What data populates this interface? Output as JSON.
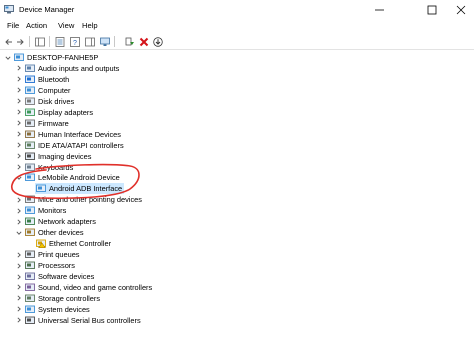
{
  "window": {
    "title": "Device Manager"
  },
  "menu": [
    {
      "label": "File",
      "x": 7
    },
    {
      "label": "Action",
      "x": 26
    },
    {
      "label": "View",
      "x": 58
    },
    {
      "label": "Help",
      "x": 82
    }
  ],
  "tree": {
    "root": "DESKTOP-FANHE5P",
    "items": [
      {
        "label": "Audio inputs and outputs",
        "icon": "speaker-icon",
        "expanded": false
      },
      {
        "label": "Bluetooth",
        "icon": "bluetooth-icon",
        "expanded": false
      },
      {
        "label": "Computer",
        "icon": "computer-icon",
        "expanded": false
      },
      {
        "label": "Disk drives",
        "icon": "disk-drive-icon",
        "expanded": false
      },
      {
        "label": "Display adapters",
        "icon": "display-adapter-icon",
        "expanded": false
      },
      {
        "label": "Firmware",
        "icon": "firmware-icon",
        "expanded": false
      },
      {
        "label": "Human Interface Devices",
        "icon": "hid-icon",
        "expanded": false
      },
      {
        "label": "IDE ATA/ATAPI controllers",
        "icon": "ide-controller-icon",
        "expanded": false
      },
      {
        "label": "Imaging devices",
        "icon": "camera-icon",
        "expanded": false
      },
      {
        "label": "Keyboards",
        "icon": "keyboard-icon",
        "expanded": false
      },
      {
        "label": "LeMobile Android Device",
        "icon": "phone-icon",
        "expanded": true,
        "children": [
          {
            "label": "Android ADB Interface",
            "icon": "phone-icon",
            "selected": true
          }
        ]
      },
      {
        "label": "Mice and other pointing devices",
        "icon": "mouse-icon",
        "expanded": false
      },
      {
        "label": "Monitors",
        "icon": "monitor-icon",
        "expanded": false
      },
      {
        "label": "Network adapters",
        "icon": "network-adapter-icon",
        "expanded": false
      },
      {
        "label": "Other devices",
        "icon": "other-device-icon",
        "expanded": true,
        "children": [
          {
            "label": "Ethernet Controller",
            "icon": "warning-device-icon",
            "selected": false
          }
        ]
      },
      {
        "label": "Print queues",
        "icon": "printer-icon",
        "expanded": false
      },
      {
        "label": "Processors",
        "icon": "processor-icon",
        "expanded": false
      },
      {
        "label": "Software devices",
        "icon": "software-device-icon",
        "expanded": false
      },
      {
        "label": "Sound, video and game controllers",
        "icon": "sound-icon",
        "expanded": false
      },
      {
        "label": "Storage controllers",
        "icon": "storage-controller-icon",
        "expanded": false
      },
      {
        "label": "System devices",
        "icon": "system-device-icon",
        "expanded": false
      },
      {
        "label": "Universal Serial Bus controllers",
        "icon": "usb-icon",
        "expanded": false
      }
    ]
  },
  "colors": {
    "selection": "#cce8ff",
    "annotation": "#e0302a",
    "uninstall_red": "#d4141a",
    "scan_green": "#2a8a2a"
  }
}
